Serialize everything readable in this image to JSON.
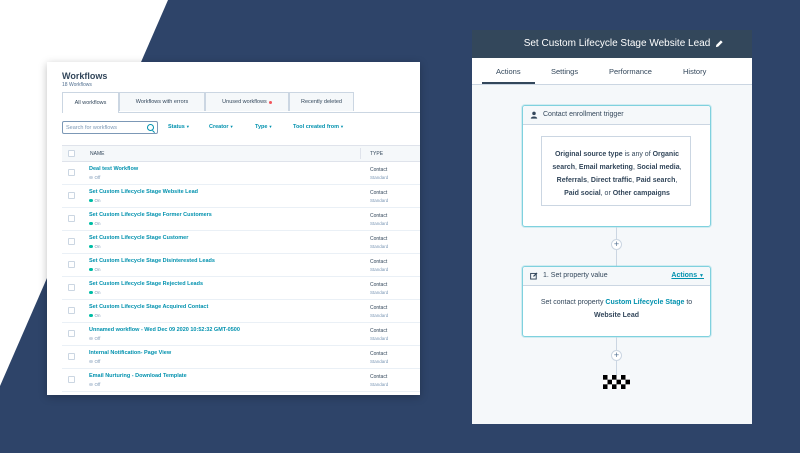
{
  "workflows": {
    "title": "Workflows",
    "count": "18 Workflows",
    "tabs": [
      {
        "label": "All workflows"
      },
      {
        "label": "Workflows with errors"
      },
      {
        "label": "Unused workflows"
      },
      {
        "label": "Recently deleted"
      }
    ],
    "search_placeholder": "Search for workflows",
    "filters": [
      "Status",
      "Creator",
      "Type",
      "Tool created from"
    ],
    "columns": {
      "name": "NAME",
      "type": "TYPE"
    },
    "rows": [
      {
        "name": "Deal test Workflow",
        "status": "Off",
        "type": "Contact",
        "subtype": "Standard"
      },
      {
        "name": "Set Custom Lifecycle Stage Website Lead",
        "status": "On",
        "type": "Contact",
        "subtype": "Standard"
      },
      {
        "name": "Set Custom Lifecycle Stage Former Customers",
        "status": "On",
        "type": "Contact",
        "subtype": "Standard"
      },
      {
        "name": "Set Custom Lifecycle Stage Customer",
        "status": "On",
        "type": "Contact",
        "subtype": "Standard"
      },
      {
        "name": "Set Custom Lifecycle Stage Disinterested Leads",
        "status": "On",
        "type": "Contact",
        "subtype": "Standard"
      },
      {
        "name": "Set Custom Lifecycle Stage Rejected Leads",
        "status": "On",
        "type": "Contact",
        "subtype": "Standard"
      },
      {
        "name": "Set Custom Lifecycle Stage Acquired Contact",
        "status": "On",
        "type": "Contact",
        "subtype": "Standard"
      },
      {
        "name": "Unnamed workflow - Wed Dec 09 2020 10:52:32 GMT-0500",
        "status": "Off",
        "type": "Contact",
        "subtype": "Standard"
      },
      {
        "name": "Internal Notification- Page View",
        "status": "Off",
        "type": "Contact",
        "subtype": "Standard"
      },
      {
        "name": "Email Nurturing - Download Template",
        "status": "Off",
        "type": "Contact",
        "subtype": "Standard"
      }
    ]
  },
  "editor": {
    "title": "Set Custom Lifecycle Stage Website Lead",
    "tabs": [
      "Actions",
      "Settings",
      "Performance",
      "History"
    ],
    "trigger": {
      "header": "Contact enrollment trigger",
      "t1": "Original source type",
      "t2": " is any of ",
      "t3": "Organic",
      "t4": "search",
      "t5": ", ",
      "t6": "Email marketing",
      "t7": ", ",
      "t8": "Social media",
      "t9": ",",
      "t10": "Referrals",
      "t11": ", ",
      "t12": "Direct traffic",
      "t13": ", ",
      "t14": "Paid search",
      "t15": ",",
      "t16": "Paid social",
      "t17": ", or ",
      "t18": "Other campaigns"
    },
    "action": {
      "header": "1. Set property value",
      "actions_label": "Actions",
      "line1_a": "Set contact property ",
      "line1_b": "Custom Lifecycle Stage",
      "line1_c": " to",
      "line2": "Website Lead"
    },
    "plus": "+"
  },
  "colors": {
    "navy_bg": "#2e4469",
    "header_dark": "#33475b",
    "link_teal": "#0091ae",
    "status_on": "#00bda5",
    "status_off": "#cbd6e2",
    "card_border": "#7fd1de"
  }
}
